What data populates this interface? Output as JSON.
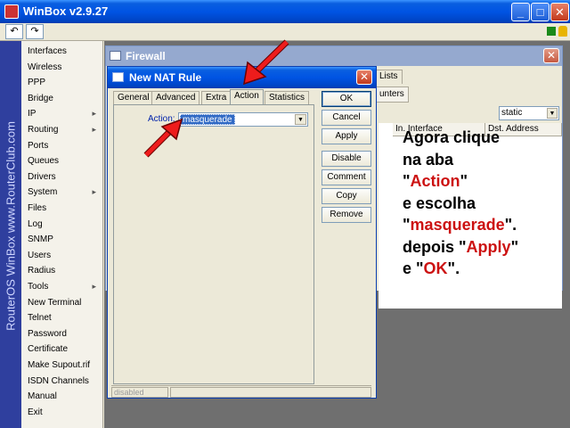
{
  "app": {
    "title": "WinBox v2.9.27",
    "brand_text": "RouterOS WinBox   www.RouterClub.com"
  },
  "window_buttons": {
    "minimize": "_",
    "maximize": "□",
    "close": "✕"
  },
  "toolbar": {
    "undo_icon": "undo-icon",
    "redo_icon": "redo-icon",
    "undo_glyph": "↶",
    "redo_glyph": "↷"
  },
  "menu": {
    "items": [
      {
        "label": "Interfaces",
        "sub": ""
      },
      {
        "label": "Wireless",
        "sub": ""
      },
      {
        "label": "PPP",
        "sub": ""
      },
      {
        "label": "Bridge",
        "sub": ""
      },
      {
        "label": "IP",
        "sub": "▸"
      },
      {
        "label": "Routing",
        "sub": "▸"
      },
      {
        "label": "Ports",
        "sub": ""
      },
      {
        "label": "Queues",
        "sub": ""
      },
      {
        "label": "Drivers",
        "sub": ""
      },
      {
        "label": "System",
        "sub": "▸"
      },
      {
        "label": "Files",
        "sub": ""
      },
      {
        "label": "Log",
        "sub": ""
      },
      {
        "label": "SNMP",
        "sub": ""
      },
      {
        "label": "Users",
        "sub": ""
      },
      {
        "label": "Radius",
        "sub": ""
      },
      {
        "label": "Tools",
        "sub": "▸"
      },
      {
        "label": "New Terminal",
        "sub": ""
      },
      {
        "label": "Telnet",
        "sub": ""
      },
      {
        "label": "Password",
        "sub": ""
      },
      {
        "label": "Certificate",
        "sub": ""
      },
      {
        "label": "Make Supout.rif",
        "sub": ""
      },
      {
        "label": "ISDN Channels",
        "sub": ""
      },
      {
        "label": "Manual",
        "sub": ""
      },
      {
        "label": "Exit",
        "sub": ""
      }
    ]
  },
  "firewall": {
    "title": "Firewall",
    "close": "✕",
    "tab_lists": "Lists",
    "btn_counters": "unters",
    "filter_value": "static",
    "columns": [
      "In. Interface",
      "Dst. Address"
    ]
  },
  "dialog": {
    "title": "New NAT Rule",
    "close": "✕",
    "tabs": [
      "General",
      "Advanced",
      "Extra",
      "Action",
      "Statistics"
    ],
    "active_tab": "Action",
    "action_label": "Action:",
    "action_value": "masquerade",
    "buttons": [
      "OK",
      "Cancel",
      "Apply",
      "Disable",
      "Comment",
      "Copy",
      "Remove"
    ],
    "status": "disabled"
  },
  "instruction": {
    "l1": "Agora clique",
    "l2": "na aba",
    "l3_q1": "\"",
    "l3_red": "Action",
    "l3_q2": "\"",
    "l4": "e escolha",
    "l5_q1": "\"",
    "l5_red": "masquerade",
    "l5_q2": "\".",
    "l6_pre": "depois \"",
    "l6_red": "Apply",
    "l6_post": "\"",
    "l7_pre": "e \"",
    "l7_red": "OK",
    "l7_post": "\"."
  },
  "colors": {
    "accent_red": "#cc1111",
    "title_blue": "#0054e3",
    "selection_blue": "#316ac5"
  }
}
